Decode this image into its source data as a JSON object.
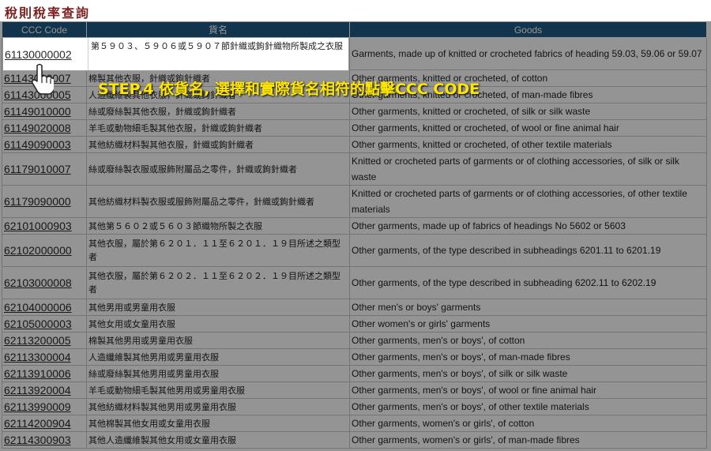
{
  "title": "稅則稅率查詢",
  "headers": {
    "code": "CCC Code",
    "name": "貨名",
    "goods": "Goods"
  },
  "rows": [
    {
      "code": "61130000002",
      "name": "第５９０３、５９０６或５９０７節針織或鉤針織物所製成之衣服",
      "goods": "Garments, made up of knitted or crocheted fabrics of heading 59.03, 59.06 or 59.07",
      "tall": true
    },
    {
      "code": "61143000007",
      "name": "棉製其他衣服，針織或鉤針織者",
      "goods": "Other garments, knitted or crocheted, of cotton"
    },
    {
      "code": "61143000005",
      "name": "人造纖維製其他衣服，針織或鉤針織者",
      "goods": "Other garments, knitted or crocheted, of man-made fibres"
    },
    {
      "code": "61149010000",
      "name": "絲或廢絲製其他衣服，針織或鉤針織者",
      "goods": "Other garments, knitted or crocheted, of silk or silk waste"
    },
    {
      "code": "61149020008",
      "name": "羊毛或動物細毛製其他衣服，針織或鉤針織者",
      "goods": "Other garments, knitted or crocheted, of wool or fine animal hair"
    },
    {
      "code": "61149090003",
      "name": "其他紡織材料製其他衣服，針織或鉤針織者",
      "goods": "Other garments, knitted or crocheted, of other textile materials"
    },
    {
      "code": "61179010007",
      "name": "絲或廢絲製衣服或服飾附屬品之零件，針織或鉤針織者",
      "goods": "Knitted or crocheted parts of garments or of clothing accessories, of silk or silk waste",
      "tall": true
    },
    {
      "code": "61179090000",
      "name": "其他紡織材料製衣服或服飾附屬品之零件，針織或鉤針織者",
      "goods": "Knitted or crocheted parts of garments or of clothing accessories, of other textile materials",
      "tall": true
    },
    {
      "code": "62101000903",
      "name": "其他第５６０２或５６０３節織物所製之衣服",
      "goods": "Other garments, made up of fabrics of headings No 5602 or 5603"
    },
    {
      "code": "62102000000",
      "name": "其他衣服，屬於第６２０１．１１至６２０１．１９目所述之類型者",
      "goods": "Other garments, of the type described in subheadings 6201.11 to 6201.19",
      "tall": true
    },
    {
      "code": "62103000008",
      "name": "其他衣服，屬於第６２０２．１１至６２０２．１９目所述之類型者",
      "goods": "Other garments, of the type described in subheading 6202.11 to 6202.19",
      "tall": true
    },
    {
      "code": "62104000006",
      "name": "其他男用或男童用衣服",
      "goods": "Other men's or boys' garments"
    },
    {
      "code": "62105000003",
      "name": "其他女用或女童用衣服",
      "goods": "Other women's or girls' garments"
    },
    {
      "code": "62113200005",
      "name": "棉製其他男用或男童用衣服",
      "goods": "Other garments, men's or boys', of cotton"
    },
    {
      "code": "62113300004",
      "name": "人造纖維製其他男用或男童用衣服",
      "goods": "Other garments, men's or boys', of man-made fibres"
    },
    {
      "code": "62113910006",
      "name": "絲或廢絲製其他男用或男童用衣服",
      "goods": "Other garments, men's or boys', of silk or silk waste"
    },
    {
      "code": "62113920004",
      "name": "羊毛或動物細毛製其他男用或男童用衣服",
      "goods": "Other garments, men's or boys', of wool or fine animal hair"
    },
    {
      "code": "62113990009",
      "name": "其他紡織材料製其他男用或男童用衣服",
      "goods": "Other garments, men's or boys', of other textile materials"
    },
    {
      "code": "62114200904",
      "name": "其他棉製其他女用或女童用衣服",
      "goods": "Other garments, women's or girls', of cotton"
    },
    {
      "code": "62114300903",
      "name": "其他人造纖維製其他女用或女童用衣服",
      "goods": "Other garments, women's or girls', of man-made fibres"
    }
  ],
  "callout": "STEP.4 依貨名, 選擇和實際貨名相符的點擊CCC CODE",
  "colors": {
    "header_bg": "#1f5c86",
    "title": "#7a1e1e",
    "callout": "#ffe600"
  },
  "icons": {
    "pointer": "hand-pointer-icon"
  }
}
